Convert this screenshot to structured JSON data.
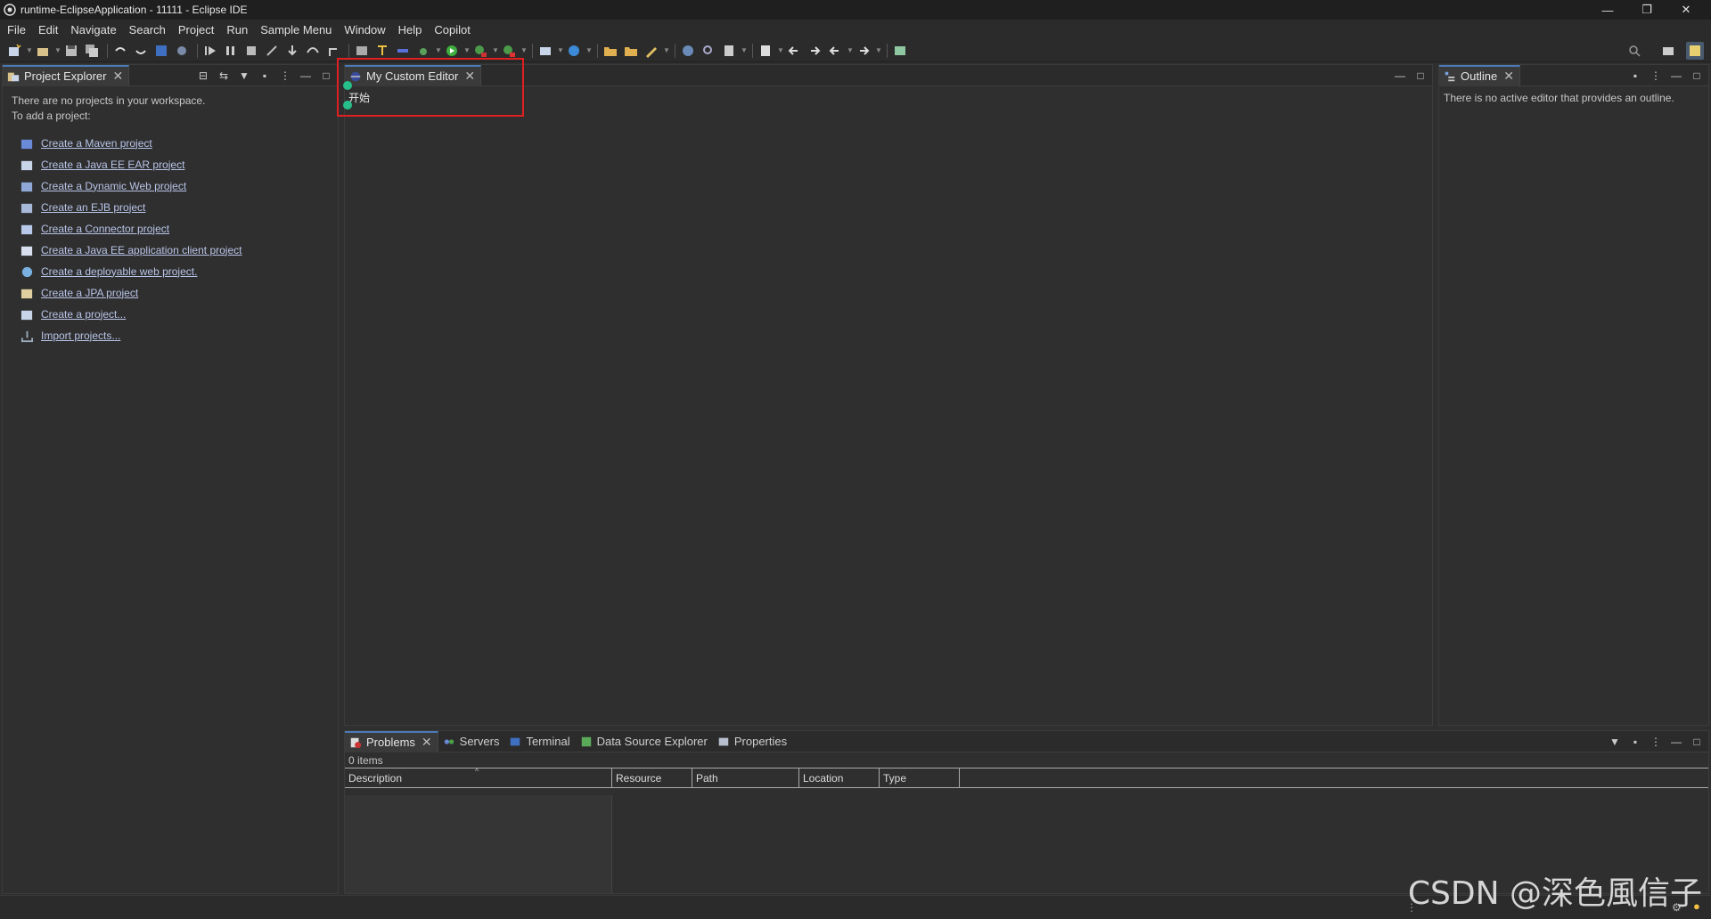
{
  "window": {
    "title": "runtime-EclipseApplication - 11111 - Eclipse IDE",
    "minimize": "—",
    "restore": "❐",
    "close": "✕"
  },
  "menu": [
    "File",
    "Edit",
    "Navigate",
    "Search",
    "Project",
    "Run",
    "Sample Menu",
    "Window",
    "Help",
    "Copilot"
  ],
  "project_explorer": {
    "tab_label": "Project Explorer",
    "intro_line1": "There are no projects in your workspace.",
    "intro_line2": "To add a project:",
    "links": [
      "Create a Maven project",
      "Create a Java EE EAR project",
      "Create a Dynamic Web project",
      "Create an EJB project",
      "Create a Connector project",
      "Create a Java EE application client project",
      "Create a deployable web project.",
      "Create a JPA project",
      "Create a project...",
      "Import projects..."
    ]
  },
  "editor": {
    "tab_label": "My Custom Editor",
    "content_text": "开始"
  },
  "outline": {
    "tab_label": "Outline",
    "message": "There is no active editor that provides an outline."
  },
  "bottom_panel": {
    "tabs": [
      "Problems",
      "Servers",
      "Terminal",
      "Data Source Explorer",
      "Properties"
    ],
    "item_count": "0 items",
    "columns": [
      "Description",
      "Resource",
      "Path",
      "Location",
      "Type"
    ]
  },
  "watermark": "CSDN @深色風信子",
  "colors": {
    "accent": "#4a7ab8",
    "highlight_box": "#e02020",
    "marker": "#27c08a",
    "link": "#b8c4e8"
  }
}
